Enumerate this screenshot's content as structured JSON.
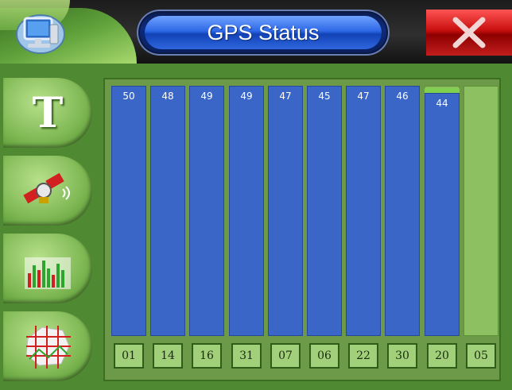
{
  "window": {
    "title": "GPS Status",
    "accent_blue": "#2e69e6",
    "close_red": "#c90f0f",
    "bar_blue": "#3a66c7",
    "bar_green": "#8dc061"
  },
  "top_bar": {
    "left_icon": "monitor-icon",
    "close_icon": "close-icon"
  },
  "sidebar": {
    "items": [
      {
        "icon": "text-icon",
        "glyph": "T"
      },
      {
        "icon": "satellite-icon"
      },
      {
        "icon": "signal-bars-icon"
      },
      {
        "icon": "map-grid-icon"
      }
    ]
  },
  "chart_data": {
    "type": "bar",
    "title": "",
    "categories": [
      "01",
      "14",
      "16",
      "31",
      "07",
      "06",
      "22",
      "30",
      "20",
      "05"
    ],
    "values": [
      50,
      48,
      49,
      49,
      47,
      45,
      47,
      46,
      44,
      null
    ],
    "value_labels": [
      "50",
      "48",
      "49",
      "49",
      "47",
      "45",
      "47",
      "46",
      "44",
      ""
    ],
    "fraction_filled": [
      1.0,
      1.0,
      1.0,
      1.0,
      1.0,
      1.0,
      1.0,
      1.0,
      0.97,
      0
    ],
    "xlabel": "",
    "ylabel": "",
    "grid": false
  }
}
